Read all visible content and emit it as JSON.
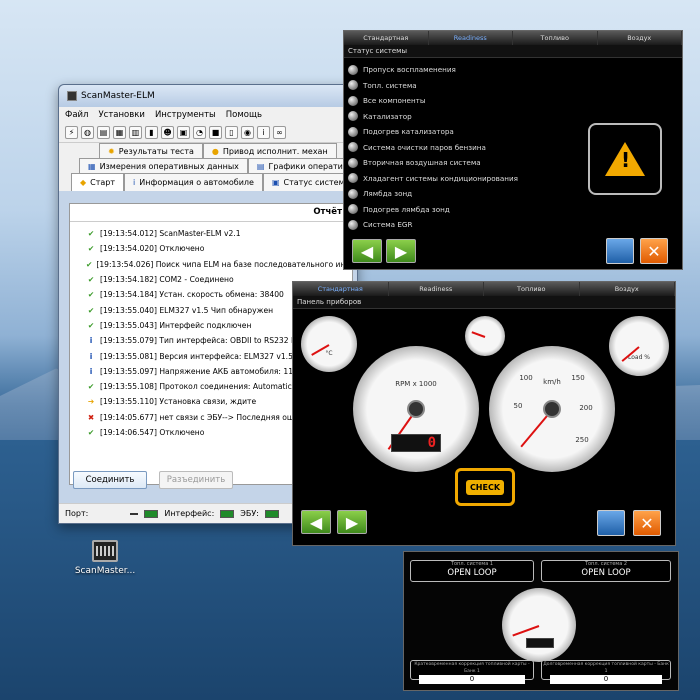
{
  "desktop": {
    "icon_label": "ScanMaster..."
  },
  "window": {
    "title": "ScanMaster-ELM",
    "menu": [
      "Файл",
      "Установки",
      "Инструменты",
      "Помощь"
    ],
    "tabs_row1": [
      "Результаты теста",
      "Привод исполнит. механ"
    ],
    "tabs_row2": [
      "Измерения оперативных данных",
      "Графики оперативных"
    ],
    "tabs_row3": [
      "Старт",
      "Информация о автомобиле",
      "Статус системы"
    ],
    "report_label": "Отчёт",
    "log": [
      {
        "icon": "check",
        "text": "[19:13:54.012] ScanMaster-ELM v2.1"
      },
      {
        "icon": "check",
        "text": "[19:13:54.020] Отключено"
      },
      {
        "icon": "check",
        "text": "[19:13:54.026] Поиск чипа ELM на базе последовательного интерф"
      },
      {
        "icon": "check",
        "text": "[19:13:54.182] COM2 - Соединено"
      },
      {
        "icon": "check",
        "text": "[19:13:54.184] Устан. скорость обмена: 38400"
      },
      {
        "icon": "check",
        "text": "[19:13:55.040] ELM327 v1.5 Чип обнаружен"
      },
      {
        "icon": "check",
        "text": "[19:13:55.043] Интерфейс подключен"
      },
      {
        "icon": "info",
        "text": "[19:13:55.079] Тип интерфейса: OBDII to RS232 Inte"
      },
      {
        "icon": "info",
        "text": "[19:13:55.081] Версия интерфейса: ELM327 v1.5"
      },
      {
        "icon": "info",
        "text": "[19:13:55.097] Напряжение АКБ автомобиля: 11.9V"
      },
      {
        "icon": "check",
        "text": "[19:13:55.108] Протокол соединения: Automatic"
      },
      {
        "icon": "arrow",
        "text": "[19:13:55.110] Установка связи, ждите"
      },
      {
        "icon": "cross",
        "text": "[19:14:05.677] нет связи с ЭБУ--> Последняя ошиб"
      },
      {
        "icon": "check",
        "text": "[19:14:06.547] Отключено"
      }
    ],
    "connect_button": "Соединить",
    "disconnect_button": "Разъединить",
    "status": {
      "port_label": "Порт:",
      "interface_label": "Интерфейс:",
      "ecu_label": "ЭБУ:"
    }
  },
  "status_panel": {
    "tabs": [
      "Стандартная",
      "Readiness",
      "Топливо",
      "Воздух"
    ],
    "subtitle": "Статус системы",
    "items": [
      "Пропуск воспламенения",
      "Топл. система",
      "Все компоненты",
      "Катализатор",
      "Подогрев катализатора",
      "Система очистки паров бензина",
      "Вторичная воздушная система",
      "Хладагент системы кондиционирования",
      "Лямбда зонд",
      "Подогрев лямбда зонд",
      "Система EGR"
    ]
  },
  "dash_panel": {
    "tabs": [
      "Стандартная",
      "Readiness",
      "Топливо",
      "Воздух"
    ],
    "subtitle": "Панель приборов",
    "rpm_label": "RPM x 1000",
    "speed_label": "km/h",
    "temp_label": "°C",
    "load_label": "Load %",
    "rpm_readout": "0",
    "check_label": "CHECK",
    "speed_ticks": [
      "50",
      "100",
      "150",
      "200",
      "250"
    ]
  },
  "fuel_panel": {
    "sys1_label": "Топл. система 1",
    "sys2_label": "Топл. система 2",
    "sys1_value": "OPEN LOOP",
    "sys2_value": "OPEN LOOP",
    "trim1_label": "Кратковременная коррекция топливной карты - Банк 1",
    "trim2_label": "Долговременная коррекция топливной карты - Банк 1",
    "trim1_value": "0",
    "trim2_value": "0"
  },
  "colors": {
    "ok": "#3a9a28",
    "err": "#d02010",
    "accent": "#7ab0ff",
    "warn": "#f2a900"
  }
}
